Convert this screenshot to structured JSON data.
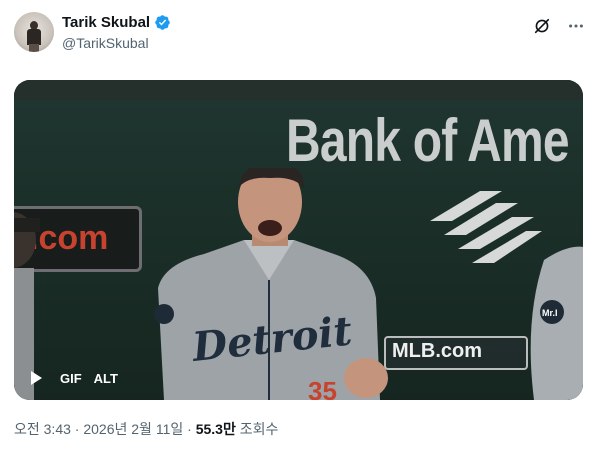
{
  "author": {
    "name": "Tarik Skubal",
    "handle": "@TarikSkubal",
    "verified": true,
    "verified_color": "#1d9bf0"
  },
  "header_actions": {
    "grok_icon": "grok-slash-circle-icon",
    "more_icon": "more-horizontal-icon"
  },
  "media": {
    "gif_label": "GIF",
    "alt_label": "ALT",
    "play_icon": "play-icon",
    "sign_text": "Bank of Ame",
    "ad_text": ".com",
    "watermark": "MLB.com",
    "jersey_text": "Detroit",
    "jersey_number": "35",
    "patch_text": "Mr.I"
  },
  "post_meta": {
    "time": "오전 3:43",
    "separator1": "·",
    "date": "2026년 2월 11일",
    "separator2": "·",
    "views_count": "55.3만",
    "views_label": "조회수"
  },
  "colors": {
    "text_primary": "#0f1419",
    "text_secondary": "#536471",
    "accent": "#1d9bf0"
  }
}
